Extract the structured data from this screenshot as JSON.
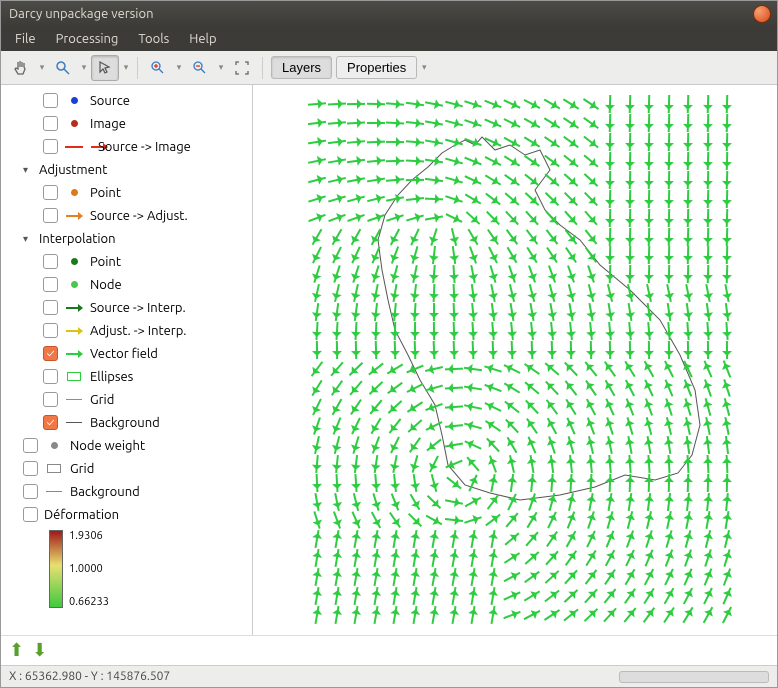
{
  "window": {
    "title": "Darcy unpackage version"
  },
  "menu": {
    "file": "File",
    "processing": "Processing",
    "tools": "Tools",
    "help": "Help"
  },
  "toolbar": {
    "layers": "Layers",
    "properties": "Properties"
  },
  "tree": {
    "source": "Source",
    "image": "Image",
    "source_image": "Source -> Image",
    "adjustment": "Adjustment",
    "adj_point": "Point",
    "adj_sa": "Source -> Adjust.",
    "interpolation": "Interpolation",
    "int_point": "Point",
    "int_node": "Node",
    "int_si": "Source -> Interp.",
    "int_ai": "Adjust. -> Interp.",
    "int_vf": "Vector field",
    "int_ell": "Ellipses",
    "int_grid": "Grid",
    "int_bg": "Background",
    "nodeweight": "Node weight",
    "grid": "Grid",
    "background": "Background",
    "deformation": "Déformation"
  },
  "legend": {
    "max": "1.9306",
    "mid": "1.0000",
    "min": "0.66233"
  },
  "status": {
    "coords": "X : 65362.980 - Y : 145876.507"
  }
}
